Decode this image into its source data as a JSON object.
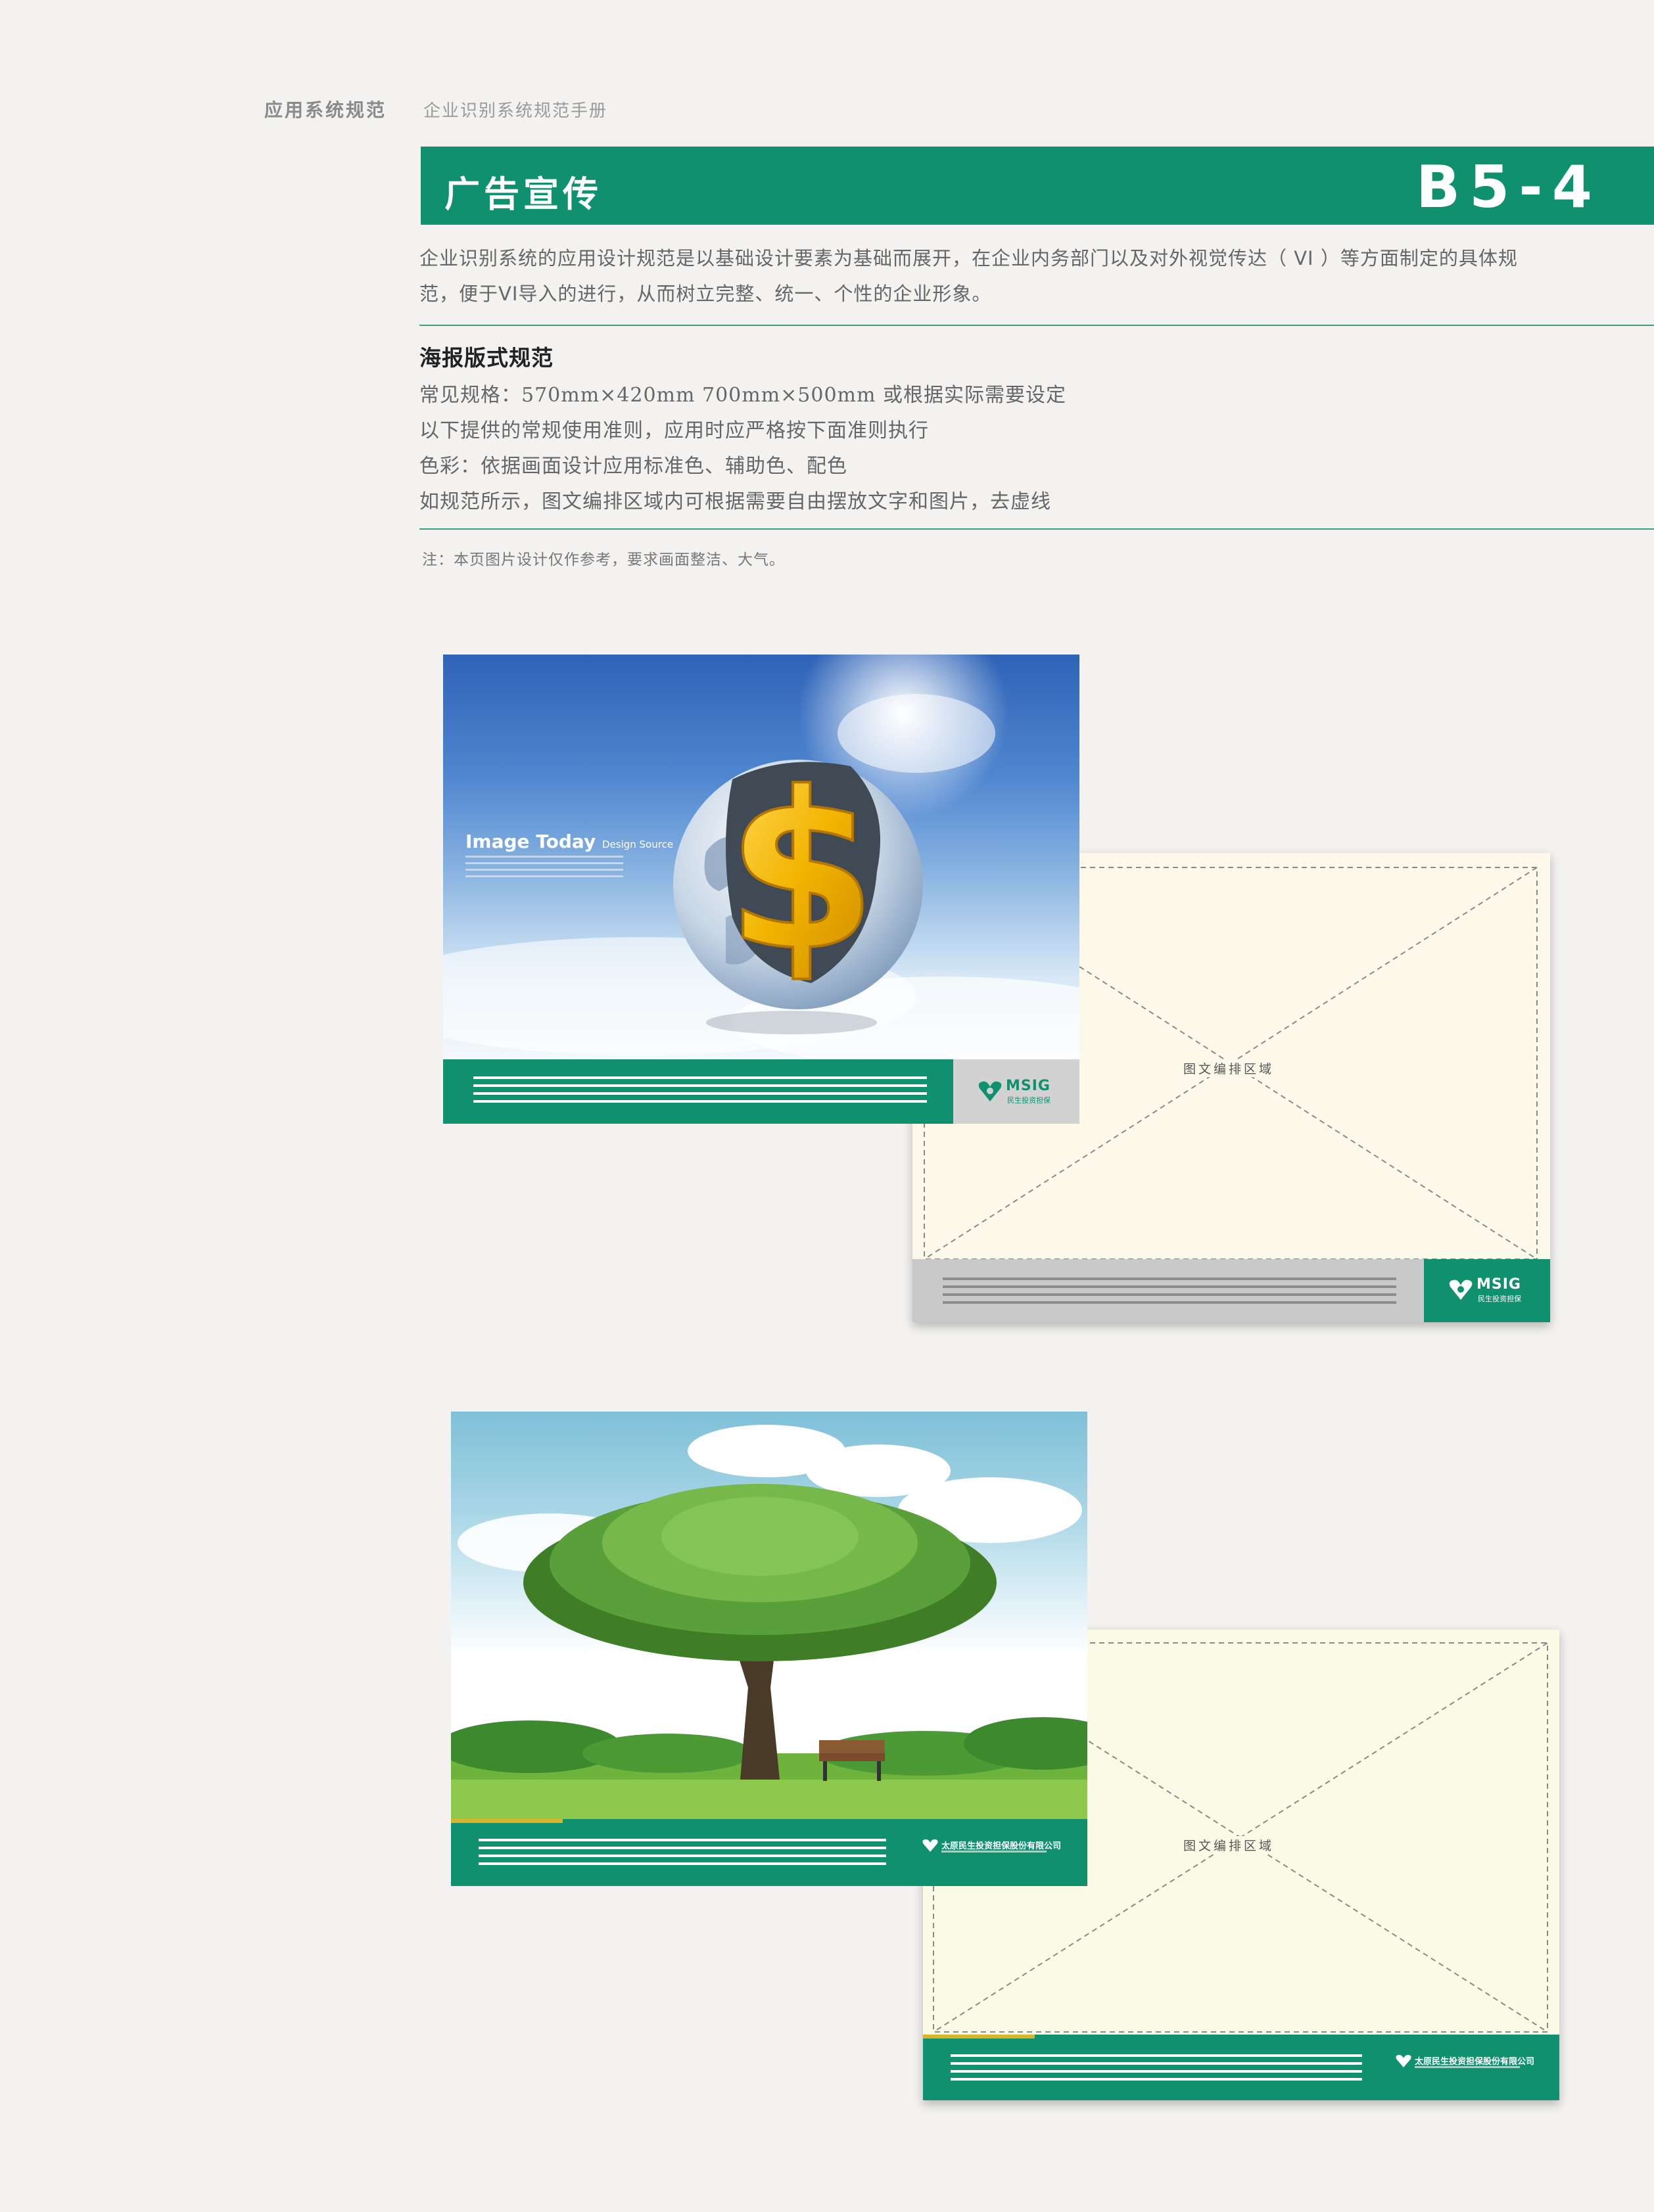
{
  "header": {
    "section": "应用系统规范",
    "manual": "企业识别系统规范手册"
  },
  "banner": {
    "title": "广告宣传",
    "code": "B5-4",
    "color": "#0f9170"
  },
  "intro": {
    "line1": "企业识别系统的应用设计规范是以基础设计要素为基础而展开，在企业内务部门以及对外视觉传达（ VI ）等方面制定的具体规",
    "line2": "范，便于VI导入的进行，从而树立完整、统一、个性的企业形象。"
  },
  "spec": {
    "title": "海报版式规范",
    "lines": [
      "常见规格：570mm×420mm    700mm×500mm    或根据实际需要设定",
      "以下提供的常规使用准则，应用时应严格按下面准则执行",
      "色彩：依据画面设计应用标准色、辅助色、配色",
      "如规范所示，图文编排区域内可根据需要自由摆放文字和图片，去虚线"
    ]
  },
  "note": "注：本页图片设计仅作参考，要求画面整洁、大气。",
  "posters": {
    "p1": {
      "photo_title": "Image Today",
      "photo_subtitle": "Design Source",
      "logo_text": "MSIG",
      "logo_sub": "民生投资担保"
    },
    "t1": {
      "area_label": "图文编排区域",
      "logo_text": "MSIG",
      "logo_sub": "民生投资担保"
    },
    "p2": {
      "company": "太原民生投资担保股份有限公司"
    },
    "t2": {
      "area_label": "图文编排区域",
      "company": "太原民生投资担保股份有限公司"
    }
  },
  "colors": {
    "brand_green": "#0f9170",
    "template_bg": "#fcf9ea",
    "accent_yellow": "#d9b32a",
    "gray_bar": "#c9c9c9"
  }
}
